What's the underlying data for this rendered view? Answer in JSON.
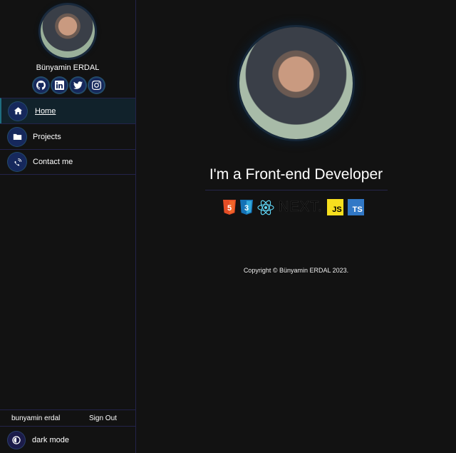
{
  "profile": {
    "name": "Bünyamin ERDAL",
    "avatar_alt": "profile photo"
  },
  "socials": [
    {
      "name": "github",
      "icon": "github-icon"
    },
    {
      "name": "linkedin",
      "icon": "linkedin-icon"
    },
    {
      "name": "twitter",
      "icon": "twitter-icon"
    },
    {
      "name": "instagram",
      "icon": "instagram-icon"
    }
  ],
  "nav": {
    "items": [
      {
        "label": "Home",
        "icon": "home-icon",
        "active": true
      },
      {
        "label": "Projects",
        "icon": "folder-icon",
        "active": false
      },
      {
        "label": "Contact me",
        "icon": "contact-icon",
        "active": false
      }
    ]
  },
  "footer": {
    "username": "bunyamin erdal",
    "sign_out": "Sign Out",
    "mode_label": "dark mode"
  },
  "main": {
    "headline": "I'm a Front-end Developer",
    "tech": [
      {
        "name": "HTML5",
        "label": "5",
        "color": "#e44d26"
      },
      {
        "name": "CSS3",
        "label": "3",
        "color": "#1572b6"
      },
      {
        "name": "React",
        "label": "",
        "color": "#61dafb"
      },
      {
        "name": "Next.js",
        "label": "NEXT.",
        "color": "#000000"
      },
      {
        "name": "JavaScript",
        "label": "JS",
        "color": "#f7df1e"
      },
      {
        "name": "TypeScript",
        "label": "TS",
        "color": "#3178c6"
      }
    ],
    "copyright": "Copyright © Bünyamin ERDAL 2023."
  },
  "colors": {
    "background": "#121212",
    "accent": "#16285c",
    "border": "#23234a"
  }
}
